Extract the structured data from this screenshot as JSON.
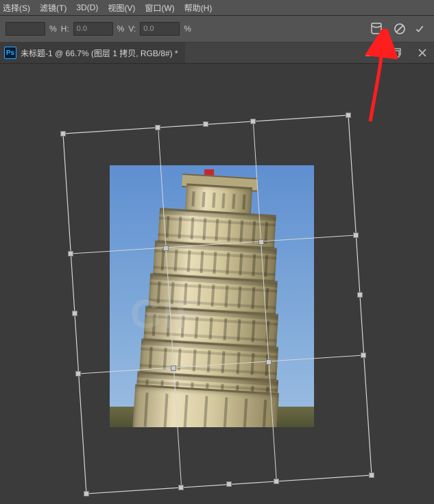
{
  "menu": {
    "select": "选择(S)",
    "filter": "滤镜(T)",
    "three_d": "3D(D)",
    "view": "视图(V)",
    "window": "窗口(W)",
    "help": "帮助(H)"
  },
  "options": {
    "percent1": "%",
    "h_label": "H:",
    "h_value": "0.0",
    "percent2": "%",
    "v_label": "V:",
    "v_value": "0.0",
    "percent3": "%"
  },
  "doc": {
    "ps_label": "Ps",
    "title": "未标题-1 @ 66.7% (图层 1 拷贝, RGB/8#) *"
  },
  "watermark_text": "GIF",
  "icons": {
    "warp": "warp-icon",
    "cancel": "cancel-icon",
    "commit": "commit-icon",
    "minimize": "minimize-icon",
    "restore": "restore-icon",
    "close": "close-icon"
  }
}
